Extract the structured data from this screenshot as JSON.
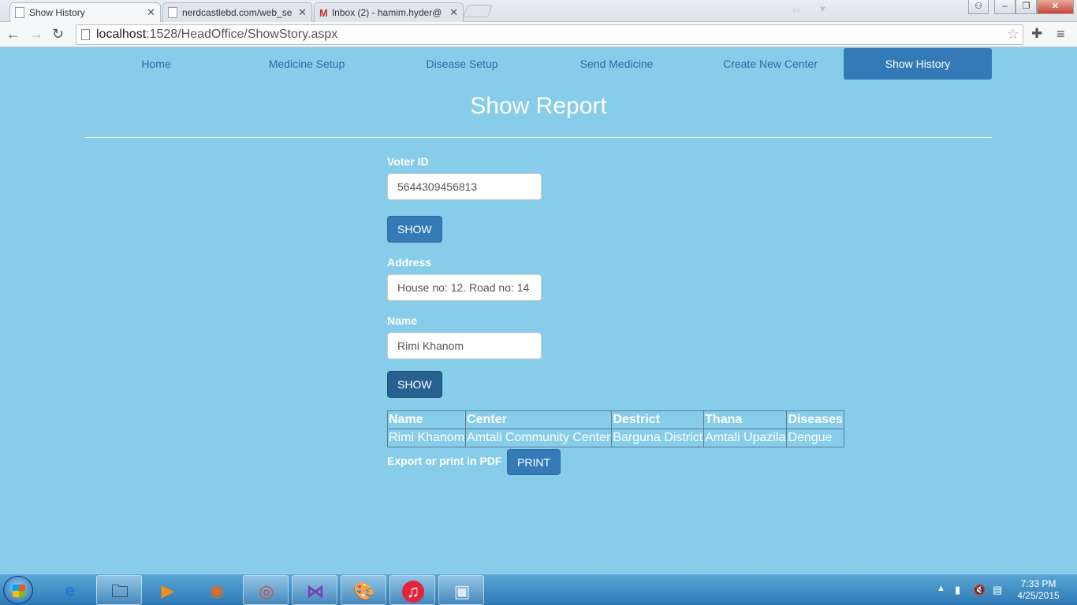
{
  "browser": {
    "tabs": [
      {
        "title": "Show History",
        "active": true
      },
      {
        "title": "nerdcastlebd.com/web_se",
        "active": false
      },
      {
        "title": "Inbox (2) - hamim.hyder@",
        "active": false
      }
    ],
    "url_host": "localhost",
    "url_path": ":1528/HeadOffice/ShowStory.aspx"
  },
  "nav": {
    "items": [
      "Home",
      "Medicine Setup",
      "Disease Setup",
      "Send Medicine",
      "Create New Center",
      "Show History"
    ],
    "active_index": 5
  },
  "page": {
    "title": "Show Report"
  },
  "form": {
    "voter_label": "Voter ID",
    "voter_value": "5644309456813",
    "show_button_1": "SHOW",
    "address_label": "Address",
    "address_value": "House no: 12. Road no: 14",
    "name_label": "Name",
    "name_value": "Rimi Khanom",
    "show_button_2": "SHOW"
  },
  "table": {
    "headers": [
      "Name",
      "Center",
      "Destrict",
      "Thana",
      "Diseases"
    ],
    "rows": [
      [
        "Rimi Khanom",
        "Amtali Community Center",
        "Barguna District",
        "Amtali Upazila",
        "Dengue"
      ]
    ]
  },
  "export": {
    "label": "Export or print in PDF",
    "print_button": "PRINT"
  },
  "taskbar": {
    "time": "7:33 PM",
    "date": "4/25/2015"
  },
  "colors": {
    "page_background": "#87CDEA",
    "primary": "#337ab7",
    "nav_link": "#2a6aad"
  }
}
